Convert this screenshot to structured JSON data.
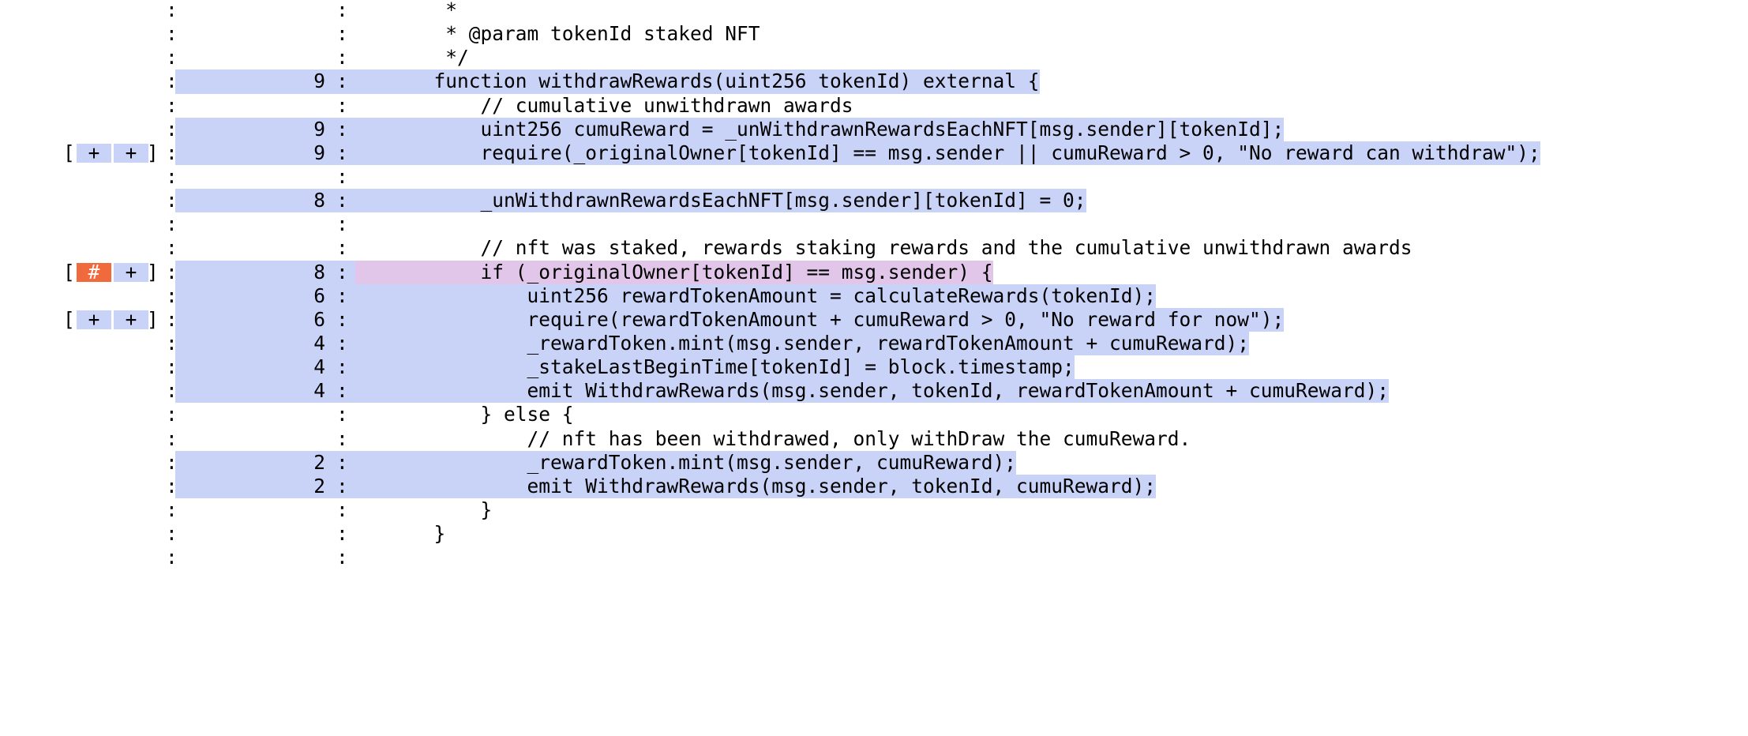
{
  "theme": {
    "covered_line_bg": "#c9d3f8",
    "partial_line_bg": "#e2c6ea",
    "branch_hit_bg": "#c9d3f8",
    "branch_miss_bg": "#f06a3d",
    "text": "#000000"
  },
  "lines": [
    {
      "branches": [],
      "count": "",
      "covered": false,
      "partial": false,
      "indent": 3,
      "code": "*"
    },
    {
      "branches": [],
      "count": "",
      "covered": false,
      "partial": false,
      "indent": 3,
      "code": "* @param tokenId staked NFT"
    },
    {
      "branches": [],
      "count": "",
      "covered": false,
      "partial": false,
      "indent": 3,
      "code": "*/"
    },
    {
      "branches": [],
      "count": "9",
      "covered": true,
      "partial": false,
      "indent": 2,
      "code": "function withdrawRewards(uint256 tokenId) external {"
    },
    {
      "branches": [],
      "count": "",
      "covered": false,
      "partial": false,
      "indent": 6,
      "code": "// cumulative unwithdrawn awards"
    },
    {
      "branches": [],
      "count": "9",
      "covered": true,
      "partial": false,
      "indent": 6,
      "code": "uint256 cumuReward = _unWithdrawnRewardsEachNFT[msg.sender][tokenId];"
    },
    {
      "branches": [
        {
          "mark": "+",
          "taken": true
        },
        {
          "mark": "+",
          "taken": true
        }
      ],
      "count": "9",
      "covered": true,
      "partial": false,
      "indent": 6,
      "code": "require(_originalOwner[tokenId] == msg.sender || cumuReward > 0, \"No reward can withdraw\");"
    },
    {
      "branches": [],
      "count": "",
      "covered": false,
      "partial": false,
      "indent": 0,
      "code": ""
    },
    {
      "branches": [],
      "count": "8",
      "covered": true,
      "partial": false,
      "indent": 6,
      "code": "_unWithdrawnRewardsEachNFT[msg.sender][tokenId] = 0;"
    },
    {
      "branches": [],
      "count": "",
      "covered": false,
      "partial": false,
      "indent": 0,
      "code": ""
    },
    {
      "branches": [],
      "count": "",
      "covered": false,
      "partial": false,
      "indent": 6,
      "code": "// nft was staked, rewards staking rewards and the cumulative unwithdrawn awards"
    },
    {
      "branches": [
        {
          "mark": "#",
          "taken": false
        },
        {
          "mark": "+",
          "taken": true
        }
      ],
      "count": "8",
      "covered": true,
      "partial": true,
      "indent": 6,
      "code": "if (_originalOwner[tokenId] == msg.sender) {"
    },
    {
      "branches": [],
      "count": "6",
      "covered": true,
      "partial": false,
      "indent": 10,
      "code": "uint256 rewardTokenAmount = calculateRewards(tokenId);"
    },
    {
      "branches": [
        {
          "mark": "+",
          "taken": true
        },
        {
          "mark": "+",
          "taken": true
        }
      ],
      "count": "6",
      "covered": true,
      "partial": false,
      "indent": 10,
      "code": "require(rewardTokenAmount + cumuReward > 0, \"No reward for now\");"
    },
    {
      "branches": [],
      "count": "4",
      "covered": true,
      "partial": false,
      "indent": 10,
      "code": "_rewardToken.mint(msg.sender, rewardTokenAmount + cumuReward);"
    },
    {
      "branches": [],
      "count": "4",
      "covered": true,
      "partial": false,
      "indent": 10,
      "code": "_stakeLastBeginTime[tokenId] = block.timestamp;"
    },
    {
      "branches": [],
      "count": "4",
      "covered": true,
      "partial": false,
      "indent": 10,
      "code": "emit WithdrawRewards(msg.sender, tokenId, rewardTokenAmount + cumuReward);"
    },
    {
      "branches": [],
      "count": "",
      "covered": false,
      "partial": false,
      "indent": 6,
      "code": "} else {"
    },
    {
      "branches": [],
      "count": "",
      "covered": false,
      "partial": false,
      "indent": 10,
      "code": "// nft has been withdrawed, only withDraw the cumuReward."
    },
    {
      "branches": [],
      "count": "2",
      "covered": true,
      "partial": false,
      "indent": 10,
      "code": "_rewardToken.mint(msg.sender, cumuReward);"
    },
    {
      "branches": [],
      "count": "2",
      "covered": true,
      "partial": false,
      "indent": 10,
      "code": "emit WithdrawRewards(msg.sender, tokenId, cumuReward);"
    },
    {
      "branches": [],
      "count": "",
      "covered": false,
      "partial": false,
      "indent": 6,
      "code": "}"
    },
    {
      "branches": [],
      "count": "",
      "covered": false,
      "partial": false,
      "indent": 2,
      "code": "}"
    },
    {
      "branches": [],
      "count": "",
      "covered": false,
      "partial": false,
      "indent": 0,
      "code": ""
    }
  ]
}
